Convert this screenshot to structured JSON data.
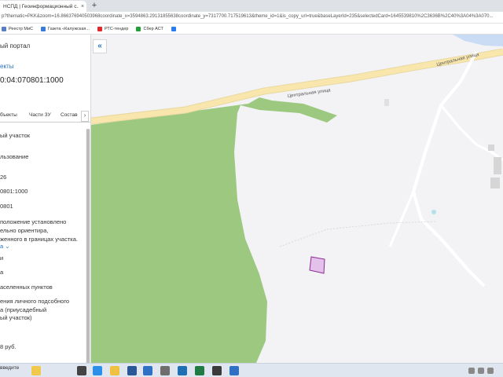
{
  "browser": {
    "tab_title": "НСПД | Геоинформационный с...",
    "tab_close": "×",
    "new_tab": "+",
    "url": "p?thematic=PKK&zoom=16.866376940503968coordinate_x=3594863.29131855638coordinate_y=7317700.717519613&theme_id=1&is_copy_url=true&baseLayerId=235&selectedCard=1645539810%2C3636B%2C40%3A04%3A070..."
  },
  "bookmarks": [
    {
      "label": "Реестр МиС",
      "color": "#5a7fbf"
    },
    {
      "label": "Газета «Калужская...",
      "color": "#3a7ad9"
    },
    {
      "label": "РТС-тендер",
      "color": "#e02a2a"
    },
    {
      "label": "Сбер АСТ",
      "color": "#21a038"
    },
    {
      "label": "",
      "color": "#2a7cf0"
    }
  ],
  "panel": {
    "portal": "ый портал",
    "objects_link": "екты",
    "cad_number": "0:04:070801:1000",
    "tabs": [
      "бъекты",
      "Части ЗУ",
      "Состав"
    ],
    "tabs_arrow": "›",
    "rows": [
      {
        "text": "ый участок",
        "link": false
      },
      {
        "text": "льзование",
        "link": false
      },
      {
        "text": "26",
        "link": false
      },
      {
        "text": "0801:1000",
        "link": false
      },
      {
        "text": "0801",
        "link": false
      },
      {
        "text": "положение установлено",
        "link": false
      },
      {
        "text": "ельно ориентира,",
        "link": false
      },
      {
        "text": "женного в границах участка.",
        "link": false
      },
      {
        "text": "а ⌄",
        "link": true
      },
      {
        "text": "и",
        "link": false
      },
      {
        "text": "а",
        "link": false
      },
      {
        "text": "аселенных пунктов",
        "link": false
      },
      {
        "text": "ения личного подсобного",
        "link": false
      },
      {
        "text": "а (приусадебный",
        "link": false
      },
      {
        "text": "ый участок)",
        "link": false
      },
      {
        "text": "8 руб.",
        "link": false
      }
    ]
  },
  "map": {
    "collapse_icon": "«",
    "road_labels": [
      "Центральная улица",
      "Центральная улица"
    ],
    "forest_color": "#9cc97f",
    "road_color": "#f8e6ad",
    "parcel_color": "#e3c1ea"
  },
  "taskbar": {
    "search_label": "введите"
  }
}
